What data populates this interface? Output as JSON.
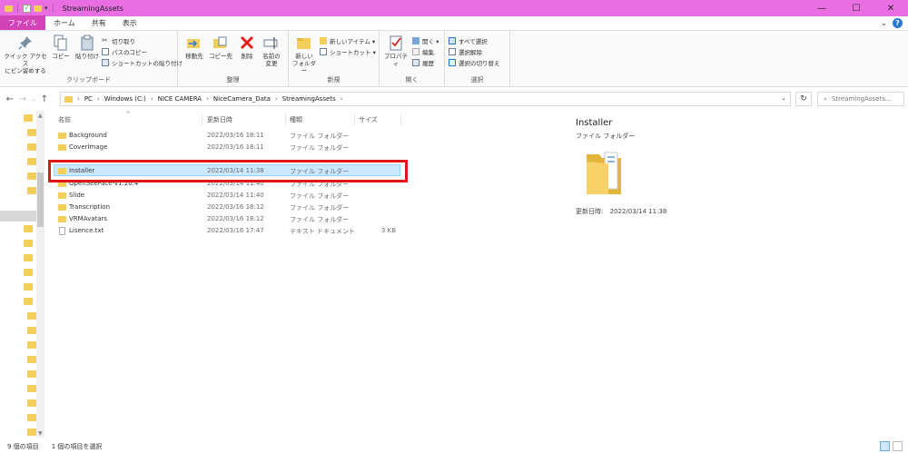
{
  "window": {
    "title": "StreamingAssets",
    "controls": {
      "minimize": "—",
      "maximize": "☐",
      "close": "✕"
    }
  },
  "menu": {
    "file": "ファイル",
    "home": "ホーム",
    "share": "共有",
    "view": "表示"
  },
  "ribbon": {
    "clipboard": {
      "label": "クリップボード",
      "pin": "クイック アクセス\nにピン留めする",
      "copy": "コピー",
      "paste": "貼り付け",
      "cut": "切り取り",
      "copy_path": "パスのコピー",
      "paste_shortcut": "ショートカットの貼り付け"
    },
    "organize": {
      "label": "整理",
      "move_to": "移動先",
      "copy_to": "コピー先",
      "delete": "削除",
      "rename": "名前の\n変更"
    },
    "new": {
      "label": "新規",
      "new_folder": "新しい\nフォルダー",
      "new_item": "新しいアイテム ▾",
      "shortcut": "ショートカット ▾"
    },
    "open": {
      "label": "開く",
      "properties": "プロパティ",
      "open": "開く ▾",
      "edit": "編集",
      "history": "履歴"
    },
    "select": {
      "label": "選択",
      "select_all": "すべて選択",
      "select_none": "選択解除",
      "invert": "選択の切り替え"
    }
  },
  "address": {
    "crumbs": [
      "PC",
      "Windows (C:)",
      "NICE CAMERA",
      "NiceCamera_Data",
      "StreamingAssets"
    ],
    "search_placeholder": "StreamingAssets..."
  },
  "columns": {
    "name": "名前",
    "modified": "更新日時",
    "type": "種類",
    "size": "サイズ"
  },
  "files": [
    {
      "name": "Background",
      "modified": "2022/03/16 18:11",
      "type": "ファイル フォルダー",
      "size": "",
      "selected": false,
      "kind": "folder"
    },
    {
      "name": "CoverImage",
      "modified": "2022/03/16 18:11",
      "type": "ファイル フォルダー",
      "size": "",
      "selected": false,
      "kind": "folder"
    },
    {
      "name": "Installer",
      "modified": "2022/03/14 11:38",
      "type": "ファイル フォルダー",
      "size": "",
      "selected": true,
      "kind": "folder"
    },
    {
      "name": "OpenSeeFace-v1.20.4",
      "modified": "2022/03/14 11:40",
      "type": "ファイル フォルダー",
      "size": "",
      "selected": false,
      "kind": "folder"
    },
    {
      "name": "Slide",
      "modified": "2022/03/14 11:40",
      "type": "ファイル フォルダー",
      "size": "",
      "selected": false,
      "kind": "folder"
    },
    {
      "name": "Transcription",
      "modified": "2022/03/16 18:12",
      "type": "ファイル フォルダー",
      "size": "",
      "selected": false,
      "kind": "folder"
    },
    {
      "name": "VRMAvatars",
      "modified": "2022/03/16 18:12",
      "type": "ファイル フォルダー",
      "size": "",
      "selected": false,
      "kind": "folder"
    },
    {
      "name": "Lisence.txt",
      "modified": "2022/03/16 17:47",
      "type": "テキスト ドキュメント",
      "size": "3 KB",
      "selected": false,
      "kind": "document"
    }
  ],
  "preview": {
    "title": "Installer",
    "type": "ファイル フォルダー",
    "modified_label": "更新日時:",
    "modified_value": "2022/03/14 11:38"
  },
  "status": {
    "count": "9 個の項目",
    "selection": "1 個の項目を選択"
  },
  "colors": {
    "titlebar": "#e96ee2",
    "file_tab": "#d243b7",
    "selection": "#cce8ff",
    "highlight_box": "#e01717",
    "folder": "#f3cf5a"
  }
}
